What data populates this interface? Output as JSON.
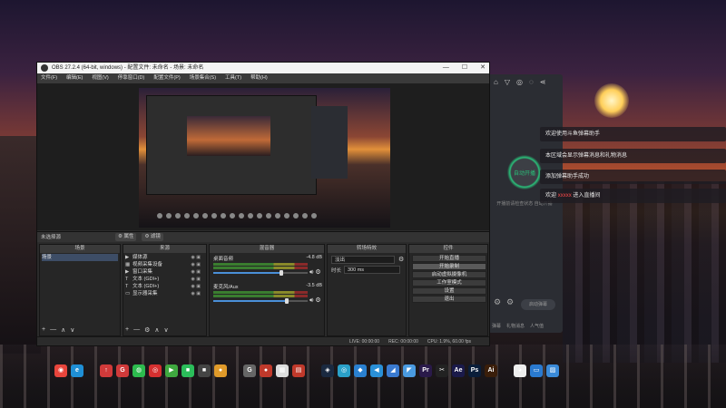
{
  "obs": {
    "title": "OBS 27.2.4 (64-bit, windows) - 配置文件: 未命名 - 场景: 未命名",
    "window_controls": [
      "—",
      "☐",
      "✕"
    ],
    "menu": [
      "文件(F)",
      "编辑(E)",
      "视图(V)",
      "停靠窗口(D)",
      "配置文件(P)",
      "场景集合(S)",
      "工具(T)",
      "帮助(H)"
    ],
    "scene_bar_label": "未选择源",
    "scene_bar_buttons": [
      "⚙ 属性",
      "⚙ 滤镜"
    ],
    "panels": {
      "scenes": "场景",
      "sources": "来源",
      "mixer": "混音器",
      "transitions": "转场特效",
      "controls": "控件"
    },
    "scenes_list": [
      "场景"
    ],
    "sources_list": [
      {
        "icon": "▶",
        "name": "媒体源"
      },
      {
        "icon": "▦",
        "name": "视频采集设备"
      },
      {
        "icon": "▶",
        "name": "窗口采集"
      },
      {
        "icon": "T",
        "name": "文本 (GDI+)"
      },
      {
        "icon": "T",
        "name": "文本 (GDI+)"
      },
      {
        "icon": "▭",
        "name": "显示器采集"
      }
    ],
    "mixer": [
      {
        "name": "桌面音频",
        "db": "-4.8 dB",
        "level": 0.72
      },
      {
        "name": "麦克风/Aux",
        "db": "-3.5 dB",
        "level": 0.78
      }
    ],
    "transition": {
      "type": "淡出",
      "duration_label": "时长",
      "duration": "300 ms"
    },
    "controls": [
      "开始直播",
      "开始录制",
      "启动虚拟摄像机",
      "工作室模式",
      "设置",
      "退出"
    ],
    "status": {
      "live": "LIVE: 00:00:00",
      "rec": "REC: 00:00:00",
      "cpu": "CPU: 1.9%, 60.00 fps"
    },
    "toolbar_glyphs": [
      "+",
      "—",
      "∧",
      "∨"
    ]
  },
  "helper": {
    "top_icons": [
      "⌂",
      "▽",
      "◎",
      "◌",
      "⋖"
    ],
    "center_label": "自动开播",
    "sub_text": "开播前请检查状态 自动开播",
    "button": "启动弹幕",
    "bottom_tabs": [
      "弹幕",
      "礼物消息",
      "人气值"
    ]
  },
  "notifications": [
    {
      "text": "欢迎使用斗鱼弹幕助手",
      "highlight": ""
    },
    {
      "text": "本区域会显示弹幕消息和礼物消息",
      "highlight": ""
    },
    {
      "text": "添加弹幕助手成功",
      "highlight": ""
    },
    {
      "text": "欢迎",
      "highlight": "xxxxx",
      "rest": "进入直播间"
    }
  ],
  "taskbar": [
    {
      "name": "chrome-icon",
      "glyph": "◉",
      "color": "#e8453c"
    },
    {
      "name": "edge-icon",
      "glyph": "e",
      "color": "#1f8fd6"
    },
    {
      "name": "tool-icon",
      "glyph": "↑",
      "color": "#d03a3a"
    },
    {
      "name": "g-icon",
      "glyph": "G",
      "color": "#d03a3a"
    },
    {
      "name": "wechat-icon",
      "glyph": "◍",
      "color": "#2dbb4e"
    },
    {
      "name": "netease-icon",
      "glyph": "◎",
      "color": "#d53030"
    },
    {
      "name": "play-icon",
      "glyph": "▶",
      "color": "#3fa83f"
    },
    {
      "name": "app-icon",
      "glyph": "■",
      "color": "#2bbd5a"
    },
    {
      "name": "app2-icon",
      "glyph": "■",
      "color": "#444"
    },
    {
      "name": "app3-icon",
      "glyph": "●",
      "color": "#e09a2a"
    },
    {
      "name": "g2-icon",
      "glyph": "G",
      "color": "#666"
    },
    {
      "name": "app4-icon",
      "glyph": "●",
      "color": "#c0392b"
    },
    {
      "name": "app5-icon",
      "glyph": "▦",
      "color": "#ddd"
    },
    {
      "name": "app6-icon",
      "glyph": "▤",
      "color": "#c0392b"
    },
    {
      "name": "steam-icon",
      "glyph": "◈",
      "color": "#1a2940"
    },
    {
      "name": "app7-icon",
      "glyph": "◎",
      "color": "#2aa0c8"
    },
    {
      "name": "app8-icon",
      "glyph": "◆",
      "color": "#2a80d0"
    },
    {
      "name": "app9-icon",
      "glyph": "◀",
      "color": "#2a90d8"
    },
    {
      "name": "app10-icon",
      "glyph": "◢",
      "color": "#3a7ad0"
    },
    {
      "name": "app11-icon",
      "glyph": "◤",
      "color": "#4a9ae0"
    },
    {
      "name": "pr-icon",
      "glyph": "Pr",
      "color": "#2a1a4a"
    },
    {
      "name": "capcut-icon",
      "glyph": "✂",
      "color": "#222"
    },
    {
      "name": "ae-icon",
      "glyph": "Ae",
      "color": "#1a1a4a"
    },
    {
      "name": "ps-icon",
      "glyph": "Ps",
      "color": "#0a1e3a"
    },
    {
      "name": "ai-icon",
      "glyph": "Ai",
      "color": "#3a1e0a"
    },
    {
      "name": "app12-icon",
      "glyph": "◕",
      "color": "#eee"
    },
    {
      "name": "app13-icon",
      "glyph": "▭",
      "color": "#2a7ad0"
    },
    {
      "name": "app14-icon",
      "glyph": "▨",
      "color": "#3a8ad8"
    }
  ]
}
